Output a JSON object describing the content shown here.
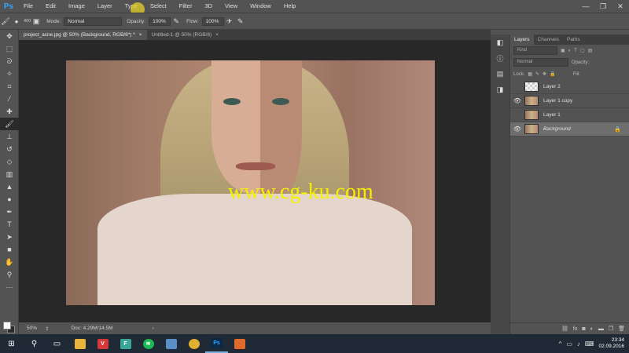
{
  "app": {
    "logo": "Ps"
  },
  "menu": [
    "File",
    "Edit",
    "Image",
    "Layer",
    "Type",
    "Select",
    "Filter",
    "3D",
    "View",
    "Window",
    "Help"
  ],
  "window_controls": {
    "minimize": "—",
    "maximize": "❐",
    "close": "✕"
  },
  "options": {
    "brush_size": "400",
    "mode_label": "Mode:",
    "mode_value": "Normal",
    "opacity_label": "Opacity:",
    "opacity_value": "100%",
    "flow_label": "Flow:",
    "flow_value": "100%"
  },
  "tabs": [
    {
      "label": "project_acne.jpg @ 50% (Background, RGB/8*) *",
      "close": "×"
    },
    {
      "label": "Untitled-1 @ 50% (RGB/8)",
      "close": "×"
    }
  ],
  "canvas": {
    "watermark": "www.cg-ku.com"
  },
  "status": {
    "zoom": "50%",
    "doc": "Doc: 4.29M/14.5M"
  },
  "panel": {
    "tabs": [
      "Layers",
      "Channels",
      "Paths"
    ],
    "filter_kind": "Kind",
    "blend_mode": "Normal",
    "opacity_label": "Opacity:",
    "lock_label": "Lock:",
    "fill_label": "Fill:",
    "layers": [
      {
        "name": "Layer 2",
        "visible": false,
        "thumb": "empty"
      },
      {
        "name": "Layer 1 copy",
        "visible": true,
        "thumb": "photo"
      },
      {
        "name": "Layer 1",
        "visible": false,
        "thumb": "photo"
      },
      {
        "name": "Background",
        "visible": true,
        "thumb": "photo",
        "locked": true
      }
    ],
    "footer_fx": "fx"
  },
  "taskbar": {
    "time": "23:34",
    "date": "02.09.2016"
  },
  "colors": {
    "accent": "#31a8ff",
    "watermark": "#f4f000",
    "taskbar": "#1f2a36"
  }
}
